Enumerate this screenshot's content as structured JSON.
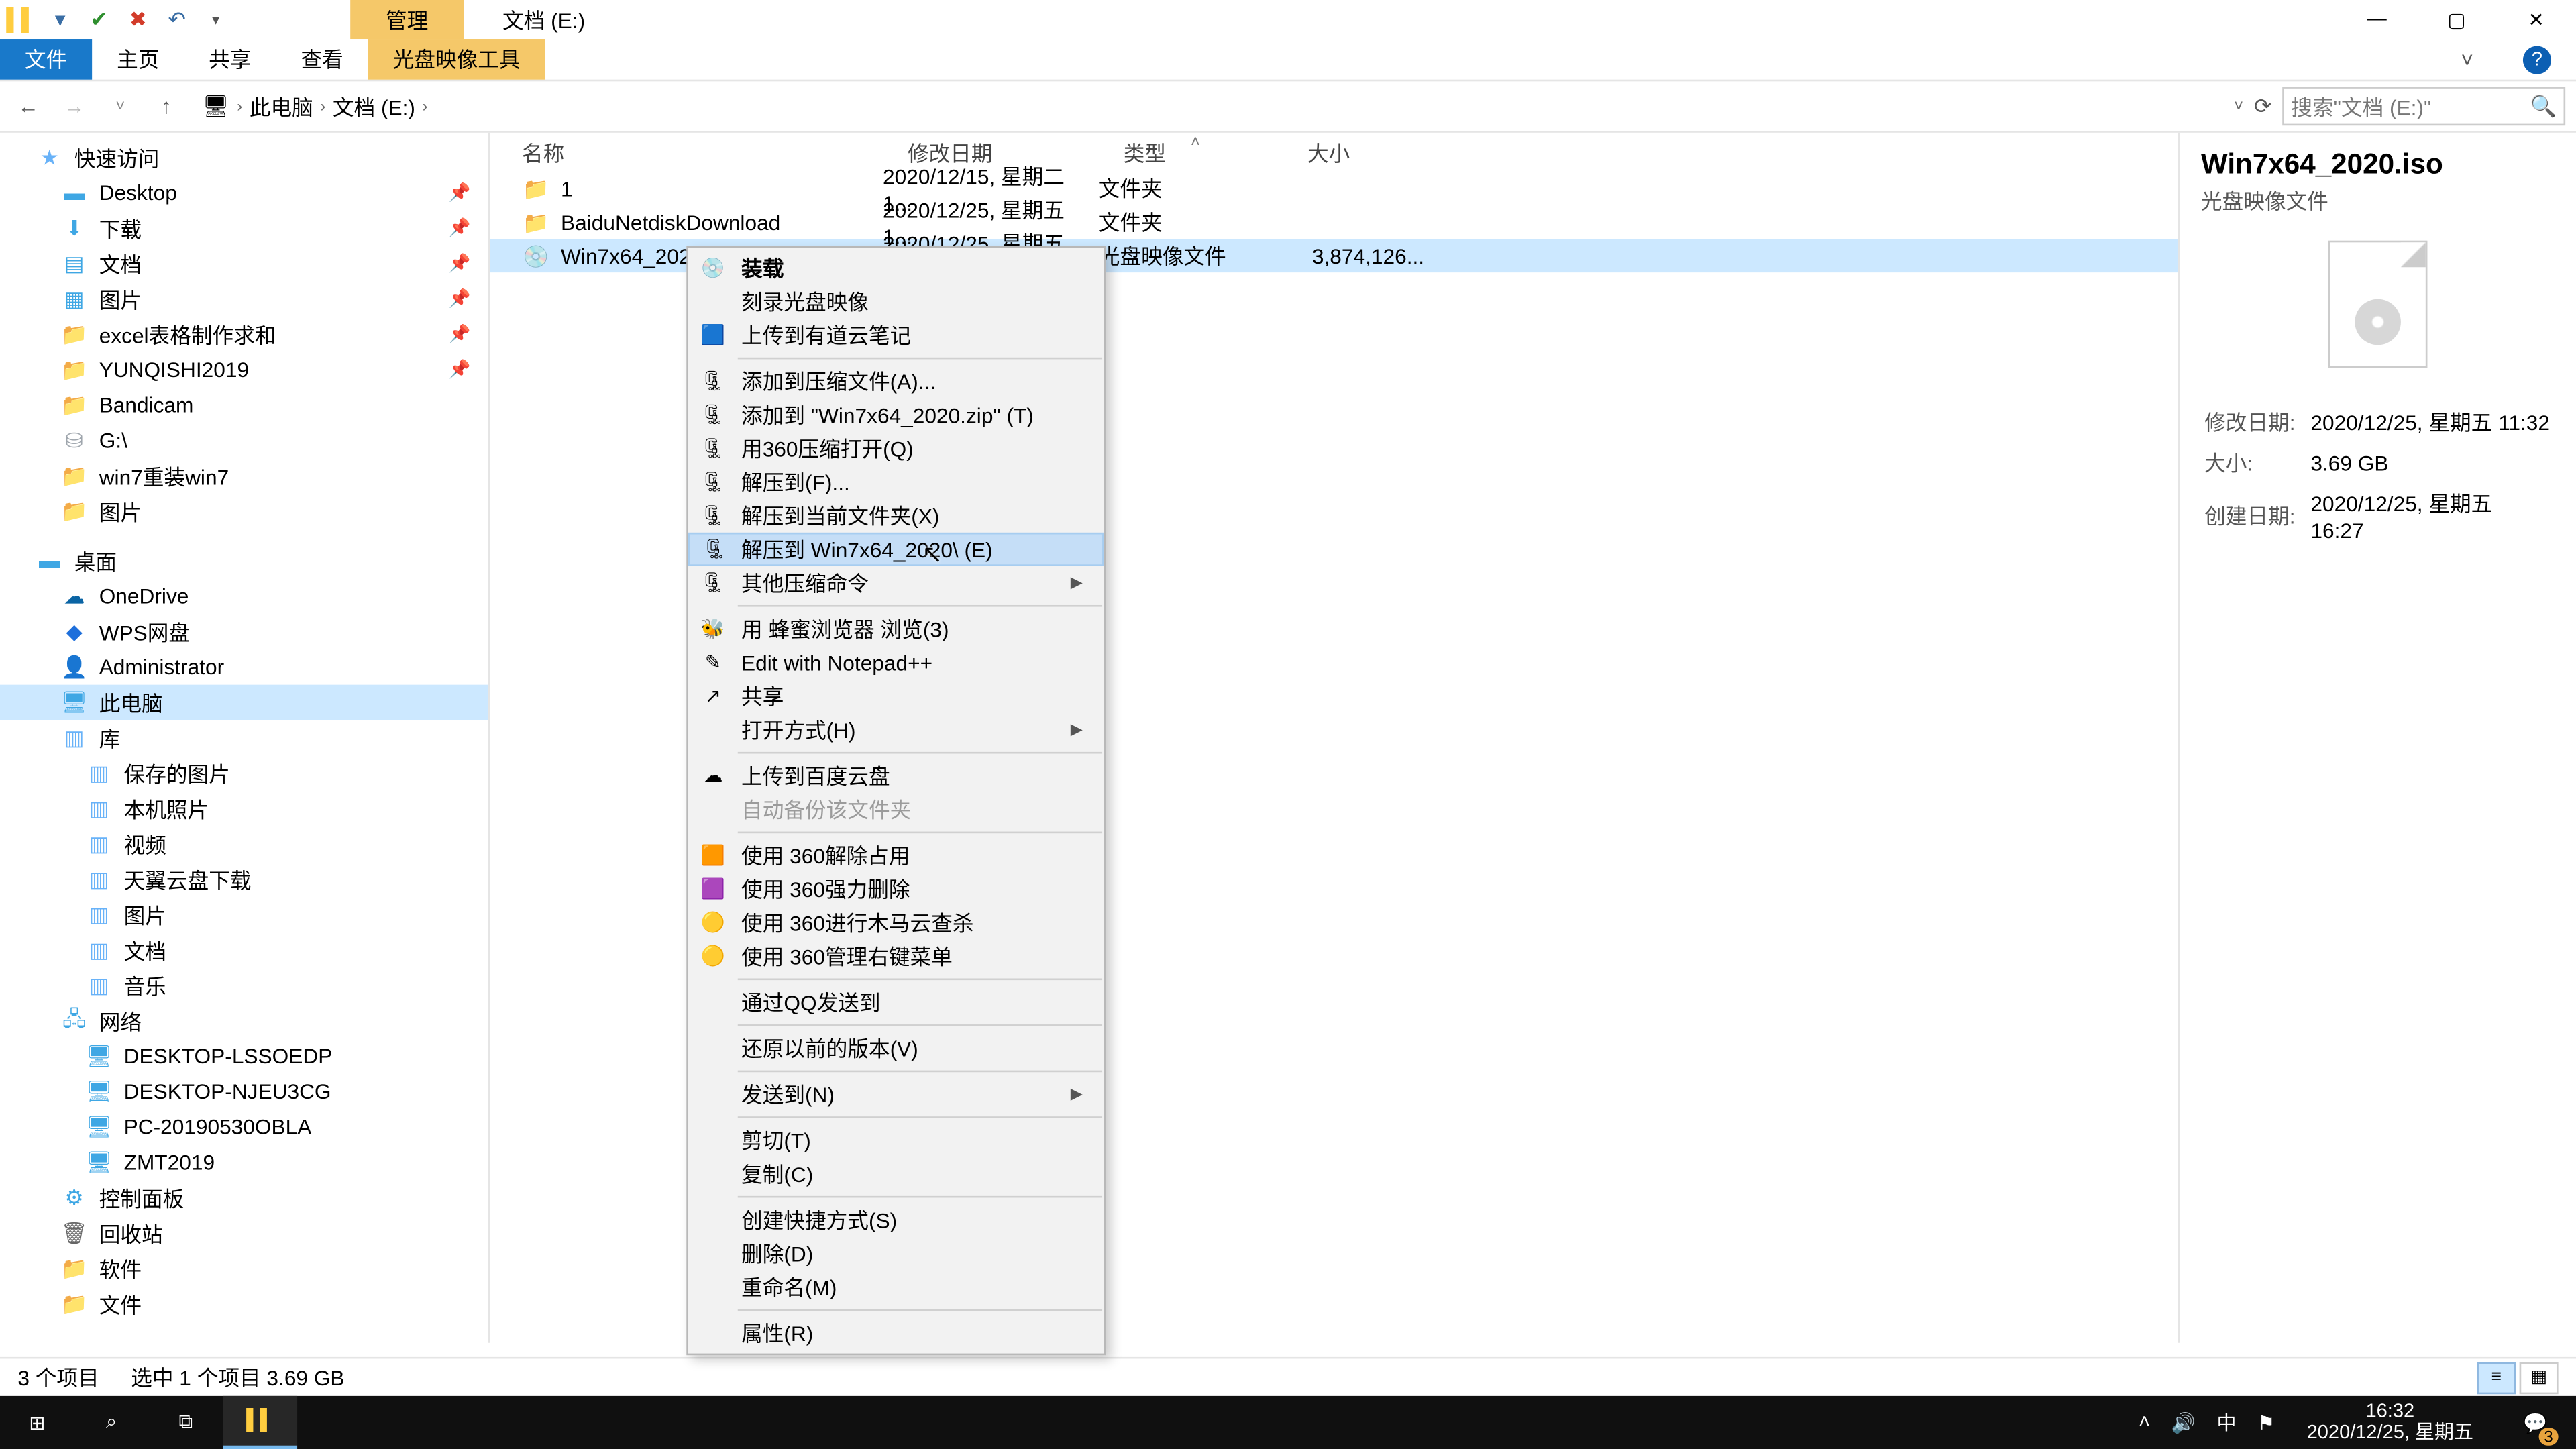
{
  "window": {
    "context_tab": "管理",
    "caption": "文档 (E:)",
    "ribbon": {
      "file": "文件",
      "home": "主页",
      "share": "共享",
      "view": "查看",
      "tool": "光盘映像工具"
    }
  },
  "nav": {
    "crumbs": [
      "此电脑",
      "文档 (E:)"
    ],
    "search_placeholder": "搜索\"文档 (E:)\""
  },
  "tree": {
    "quick": "快速访问",
    "quick_items": [
      "Desktop",
      "下载",
      "文档",
      "图片",
      "excel表格制作求和",
      "YUNQISHI2019",
      "Bandicam",
      "G:\\",
      "win7重装win7",
      "图片"
    ],
    "desktop": "桌面",
    "desktop_items": [
      "OneDrive",
      "WPS网盘",
      "Administrator",
      "此电脑",
      "库"
    ],
    "lib_items": [
      "保存的图片",
      "本机照片",
      "视频",
      "天翼云盘下载",
      "图片",
      "文档",
      "音乐"
    ],
    "network": "网络",
    "net_items": [
      "DESKTOP-LSSOEDP",
      "DESKTOP-NJEU3CG",
      "PC-20190530OBLA",
      "ZMT2019"
    ],
    "others": [
      "控制面板",
      "回收站",
      "软件",
      "文件"
    ]
  },
  "columns": {
    "name": "名称",
    "date": "修改日期",
    "type": "类型",
    "size": "大小"
  },
  "rows": [
    {
      "name": "1",
      "date": "2020/12/15, 星期二 1...",
      "type": "文件夹",
      "size": ""
    },
    {
      "name": "BaiduNetdiskDownload",
      "date": "2020/12/25, 星期五 1...",
      "type": "文件夹",
      "size": ""
    },
    {
      "name": "Win7x64_2020.iso",
      "date": "2020/12/25, 星期五 1...",
      "type": "光盘映像文件",
      "size": "3,874,126..."
    }
  ],
  "preview": {
    "title": "Win7x64_2020.iso",
    "subtitle": "光盘映像文件",
    "mdate_label": "修改日期:",
    "mdate": "2020/12/25, 星期五 11:32",
    "size_label": "大小:",
    "size": "3.69 GB",
    "cdate_label": "创建日期:",
    "cdate": "2020/12/25, 星期五 16:27"
  },
  "context_menu": [
    {
      "label": "装载",
      "icon": "disc",
      "bold": true
    },
    {
      "label": "刻录光盘映像"
    },
    {
      "label": "上传到有道云笔记",
      "icon": "note"
    },
    {
      "sep": true
    },
    {
      "label": "添加到压缩文件(A)...",
      "icon": "zip"
    },
    {
      "label": "添加到 \"Win7x64_2020.zip\" (T)",
      "icon": "zip"
    },
    {
      "label": "用360压缩打开(Q)",
      "icon": "zip"
    },
    {
      "label": "解压到(F)...",
      "icon": "zip"
    },
    {
      "label": "解压到当前文件夹(X)",
      "icon": "zip"
    },
    {
      "label": "解压到 Win7x64_2020\\ (E)",
      "icon": "zip",
      "hover": true
    },
    {
      "label": "其他压缩命令",
      "icon": "zip",
      "arrow": true
    },
    {
      "sep": true
    },
    {
      "label": "用 蜂蜜浏览器 浏览(3)",
      "icon": "bee"
    },
    {
      "label": "Edit with Notepad++",
      "icon": "npp"
    },
    {
      "label": "共享",
      "icon": "share"
    },
    {
      "label": "打开方式(H)",
      "arrow": true
    },
    {
      "sep": true
    },
    {
      "label": "上传到百度云盘",
      "icon": "baidu"
    },
    {
      "label": "自动备份该文件夹",
      "disabled": true
    },
    {
      "sep": true
    },
    {
      "label": "使用 360解除占用",
      "icon": "360a"
    },
    {
      "label": "使用 360强力删除",
      "icon": "360b"
    },
    {
      "label": "使用 360进行木马云查杀",
      "icon": "360c"
    },
    {
      "label": "使用 360管理右键菜单",
      "icon": "360c"
    },
    {
      "sep": true
    },
    {
      "label": "通过QQ发送到"
    },
    {
      "sep": true
    },
    {
      "label": "还原以前的版本(V)"
    },
    {
      "sep": true
    },
    {
      "label": "发送到(N)",
      "arrow": true
    },
    {
      "sep": true
    },
    {
      "label": "剪切(T)"
    },
    {
      "label": "复制(C)"
    },
    {
      "sep": true
    },
    {
      "label": "创建快捷方式(S)"
    },
    {
      "label": "删除(D)"
    },
    {
      "label": "重命名(M)"
    },
    {
      "sep": true
    },
    {
      "label": "属性(R)"
    }
  ],
  "status": {
    "count": "3 个项目",
    "selection": "选中 1 个项目  3.69 GB"
  },
  "taskbar": {
    "time": "16:32",
    "date": "2020/12/25, 星期五",
    "ime": "中",
    "notif_count": "3"
  }
}
